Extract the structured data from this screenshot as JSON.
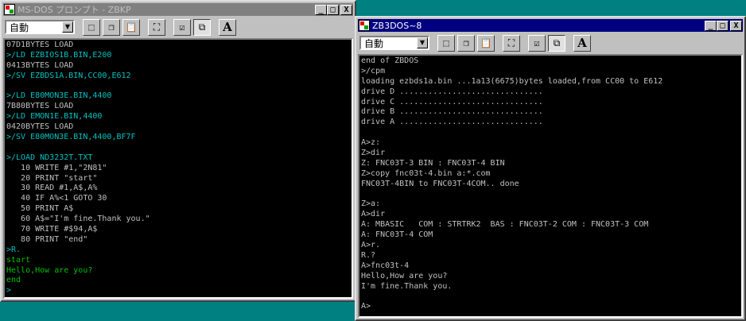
{
  "left_window": {
    "title": "MS-DOS プロンプト - ZBKP",
    "font_select": "自動",
    "lines": [
      {
        "text": "07D1BYTES LOAD",
        "color": "white"
      },
      {
        "text": ">/LD EZBIOS1B.BIN,E200",
        "color": "cyan"
      },
      {
        "text": "0413BYTES LOAD",
        "color": "white"
      },
      {
        "text": ">/SV EZBDS1A.BIN,CC00,E612",
        "color": "cyan"
      },
      {
        "text": "",
        "color": "white"
      },
      {
        "text": ">/LD E80MON3E.BIN,4400",
        "color": "cyan"
      },
      {
        "text": "7B80BYTES LOAD",
        "color": "white"
      },
      {
        "text": ">/LD EMON1E.BIN,4400",
        "color": "cyan"
      },
      {
        "text": "0420BYTES LOAD",
        "color": "white"
      },
      {
        "text": ">/SV E80MON3E.BIN,4400,BF7F",
        "color": "cyan"
      },
      {
        "text": "",
        "color": "white"
      },
      {
        "text": ">/LOAD ND3232T.TXT",
        "color": "cyan"
      },
      {
        "text": "   10 WRITE #1,\"2N81\"",
        "color": "white"
      },
      {
        "text": "   20 PRINT \"start\"",
        "color": "white"
      },
      {
        "text": "   30 READ #1,A$,A%",
        "color": "white"
      },
      {
        "text": "   40 IF A%<1 GOTO 30",
        "color": "white"
      },
      {
        "text": "   50 PRINT A$",
        "color": "white"
      },
      {
        "text": "   60 A$=\"I'm fine.Thank you.\"",
        "color": "white"
      },
      {
        "text": "   70 WRITE #$94,A$",
        "color": "white"
      },
      {
        "text": "   80 PRINT \"end\"",
        "color": "white"
      },
      {
        "text": ">R.",
        "color": "cyan"
      },
      {
        "text": "start",
        "color": "green"
      },
      {
        "text": "Hello,How are you?",
        "color": "green"
      },
      {
        "text": "end",
        "color": "green"
      },
      {
        "text": ">",
        "color": "cyan"
      }
    ]
  },
  "right_window": {
    "title": "ZB3DOS~8",
    "font_select": "自動",
    "lines": [
      {
        "text": "end of ZBDOS",
        "color": "white"
      },
      {
        "text": ">/cpm",
        "color": "white"
      },
      {
        "text": "loading ezbds1a.bin ...1a13(6675)bytes loaded,from CC00 to E612",
        "color": "white"
      },
      {
        "text": "drive D ..............................",
        "color": "white"
      },
      {
        "text": "drive C ..............................",
        "color": "white"
      },
      {
        "text": "drive B ..............................",
        "color": "white"
      },
      {
        "text": "drive A ..............................",
        "color": "white"
      },
      {
        "text": "",
        "color": "white"
      },
      {
        "text": "A>z:",
        "color": "white"
      },
      {
        "text": "Z>dir",
        "color": "white"
      },
      {
        "text": "Z: FNC03T-3 BIN : FNC03T-4 BIN",
        "color": "white"
      },
      {
        "text": "Z>copy fnc03t-4.bin a:*.com",
        "color": "white"
      },
      {
        "text": "FNC03T-4BIN to FNC03T-4COM.. done",
        "color": "white"
      },
      {
        "text": "",
        "color": "white"
      },
      {
        "text": "Z>a:",
        "color": "white"
      },
      {
        "text": "A>dir",
        "color": "white"
      },
      {
        "text": "A: MBASIC   COM : STRTRK2  BAS : FNC03T-2 COM : FNC03T-3 COM",
        "color": "white"
      },
      {
        "text": "A: FNC03T-4 COM",
        "color": "white"
      },
      {
        "text": "A>r.",
        "color": "white"
      },
      {
        "text": "R.?",
        "color": "white"
      },
      {
        "text": "A>fnc03t-4",
        "color": "white"
      },
      {
        "text": "Hello,How are you?",
        "color": "white"
      },
      {
        "text": "I'm fine.Thank you.",
        "color": "white"
      },
      {
        "text": "",
        "color": "white"
      },
      {
        "text": "A>",
        "color": "white"
      }
    ]
  },
  "toolbar": {
    "buttons": [
      {
        "name": "mark-button",
        "icon": "mark-icon"
      },
      {
        "name": "copy-button",
        "icon": "copy-icon"
      },
      {
        "name": "paste-button",
        "icon": "paste-icon"
      },
      {
        "name": "fullscreen-button",
        "icon": "fullscreen-icon"
      },
      {
        "name": "properties-button",
        "icon": "properties-icon"
      },
      {
        "name": "background-button",
        "icon": "background-icon"
      },
      {
        "name": "font-button",
        "icon": "font-icon"
      }
    ],
    "font_button_label": "A",
    "minimize_glyph": "_",
    "maximize_glyph": "□",
    "close_glyph": "X"
  },
  "colors": {
    "desktop": "#008080",
    "console_bg": "#000000",
    "console_text": "#c0c0c0",
    "cyan": "#00c0c0",
    "green": "#00c000",
    "active_title": "#000080",
    "inactive_title": "#808080"
  }
}
